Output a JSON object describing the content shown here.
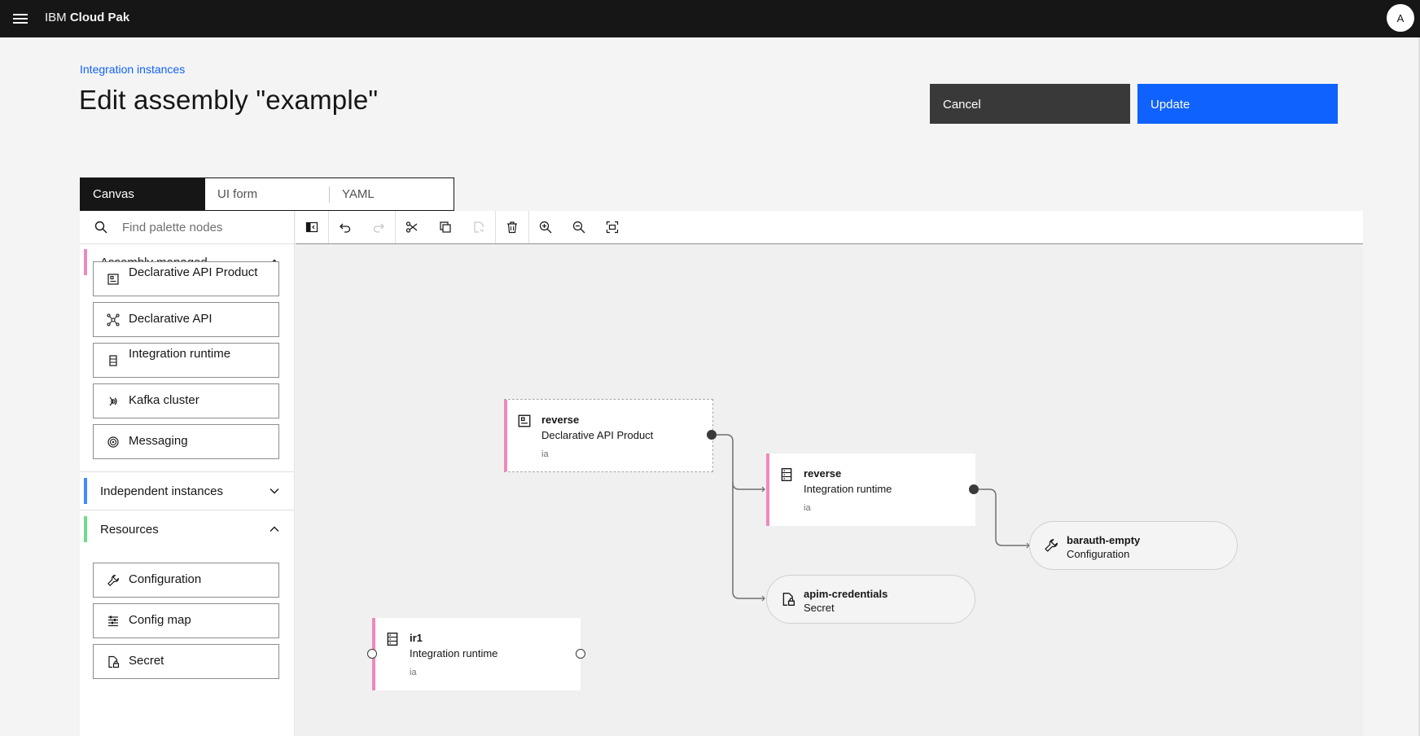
{
  "header": {
    "brand_prefix": "IBM",
    "brand_name": "Cloud Pak",
    "avatar_initial": "A"
  },
  "page": {
    "breadcrumb": "Integration instances",
    "title": "Edit assembly \"example\"",
    "cancel_label": "Cancel",
    "update_label": "Update"
  },
  "tabs": [
    "Canvas",
    "UI form",
    "YAML"
  ],
  "palette": {
    "search_placeholder": "Find palette nodes",
    "groups": [
      {
        "label": "Assembly managed",
        "color": "#ee89bc",
        "expanded": true,
        "items": [
          {
            "label": "Declarative API Product",
            "icon": "api-product-icon"
          },
          {
            "label": "Declarative API",
            "icon": "api-network-icon"
          },
          {
            "label": "Integration runtime",
            "icon": "server-icon"
          },
          {
            "label": "Kafka cluster",
            "icon": "kafka-icon"
          },
          {
            "label": "Messaging",
            "icon": "messaging-icon"
          }
        ]
      },
      {
        "label": "Independent instances",
        "color": "#4589ff",
        "expanded": false,
        "items": []
      },
      {
        "label": "Resources",
        "color": "#6fdc8c",
        "expanded": true,
        "items": [
          {
            "label": "Configuration",
            "icon": "wrench-icon"
          },
          {
            "label": "Config map",
            "icon": "config-map-icon"
          },
          {
            "label": "Secret",
            "icon": "secret-icon"
          }
        ]
      }
    ]
  },
  "toolbar": [
    "toggle-palette",
    "undo",
    "redo",
    "cut",
    "copy",
    "paste",
    "delete",
    "zoom-in",
    "zoom-out",
    "zoom-fit"
  ],
  "canvas": {
    "nodes": [
      {
        "title": "reverse",
        "subtitle": "Declarative API Product",
        "namespace": "ia"
      },
      {
        "title": "reverse",
        "subtitle": "Integration runtime",
        "namespace": "ia"
      },
      {
        "title": "barauth-empty",
        "subtitle": "Configuration"
      },
      {
        "title": "apim-credentials",
        "subtitle": "Secret"
      },
      {
        "title": "ir1",
        "subtitle": "Integration runtime",
        "namespace": "ia"
      }
    ]
  }
}
